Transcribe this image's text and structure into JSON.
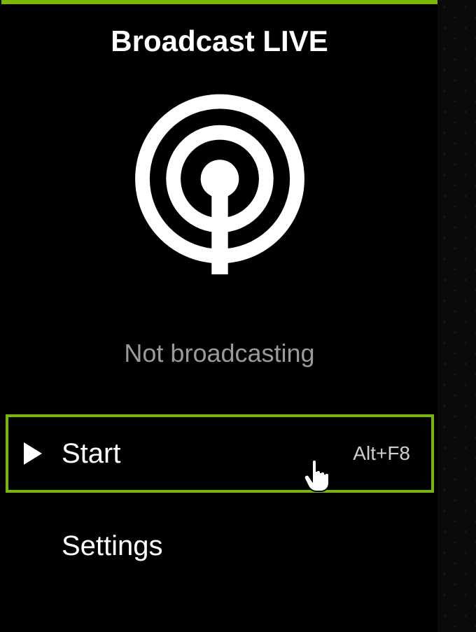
{
  "header": {
    "title": "Broadcast LIVE"
  },
  "status": {
    "text": "Not broadcasting",
    "icon": "broadcast-antenna-icon"
  },
  "actions": {
    "start": {
      "label": "Start",
      "shortcut": "Alt+F8",
      "icon": "play-icon",
      "highlighted": true
    },
    "settings": {
      "label": "Settings"
    }
  },
  "colors": {
    "accent": "#7ab800",
    "background": "#000000",
    "text_primary": "#ffffff",
    "text_secondary": "#9a9a9a"
  },
  "cursor": {
    "type": "pointer-hand"
  }
}
